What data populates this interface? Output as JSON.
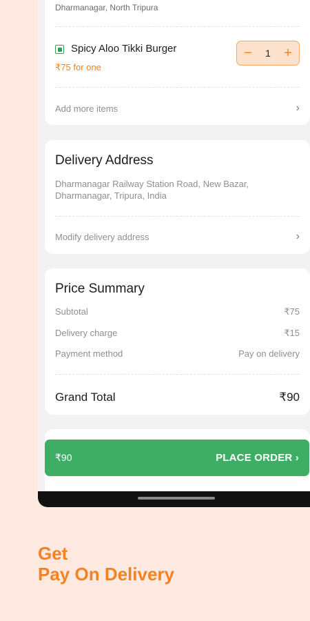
{
  "order": {
    "restaurant_location": "Dharmanagar, North Tripura",
    "item": {
      "name": "Spicy Aloo Tikki Burger",
      "price": "₹75 for one",
      "quantity": "1"
    },
    "add_more_label": "Add more items"
  },
  "address": {
    "title": "Delivery Address",
    "text": "Dharmanagar Railway Station Road, New Bazar, Dharmanagar, Tripura, India",
    "modify_label": "Modify delivery address"
  },
  "price_summary": {
    "title": "Price Summary",
    "subtotal_label": "Subtotal",
    "subtotal_value": "₹75",
    "delivery_label": "Delivery charge",
    "delivery_value": "₹15",
    "payment_label": "Payment method",
    "payment_value": "Pay on delivery",
    "grand_label": "Grand Total",
    "grand_value": "₹90"
  },
  "place_order": {
    "amount": "₹90",
    "label": "PLACE ORDER ›"
  },
  "promo": {
    "line1": "Get",
    "line2": "Pay On Delivery"
  },
  "colors": {
    "accent": "#f58220",
    "cta": "#3dae63",
    "veg": "#2e9e4f",
    "background": "#fde9df"
  },
  "icons": [
    "veg-indicator-icon",
    "minus-icon",
    "plus-icon",
    "chevron-right-icon"
  ]
}
